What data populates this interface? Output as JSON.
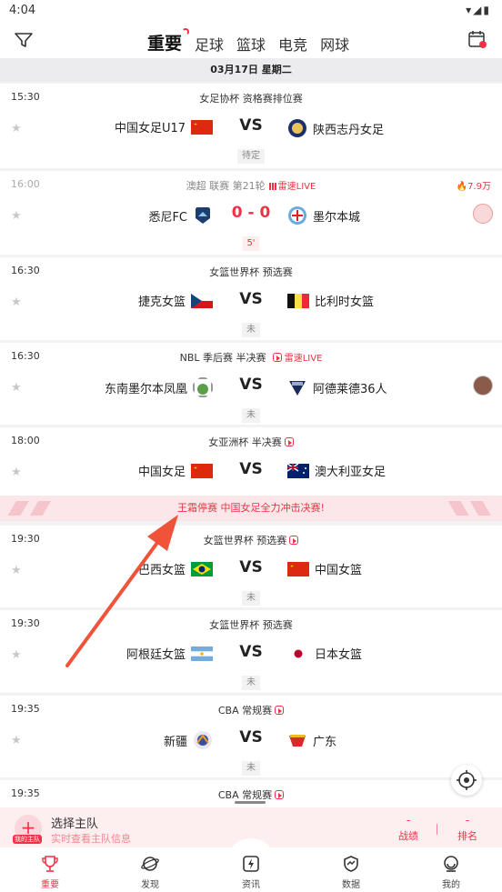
{
  "status_bar": {
    "time": "4:04",
    "icons": "▾◢▮"
  },
  "tabs": [
    "重要",
    "足球",
    "篮球",
    "电竞",
    "网球"
  ],
  "date_header": "03月17日 星期二",
  "matches": [
    {
      "time": "15:30",
      "competition": "女足协杯 资格赛排位赛",
      "home": "中国女足U17",
      "away": "陕西志丹女足",
      "center": "VS",
      "status": "待定"
    },
    {
      "time": "16:00",
      "competition": "澳超 联赛 第21轮",
      "live_label": "雷速LIVE",
      "heat": "7.9万",
      "home": "悉尼FC",
      "away": "墨尔本城",
      "center": "0 - 0",
      "status": "5'"
    },
    {
      "time": "16:30",
      "competition": "女篮世界杯 预选赛",
      "home": "捷克女篮",
      "away": "比利时女篮",
      "center": "VS",
      "status": "未"
    },
    {
      "time": "16:30",
      "competition": "NBL 季后赛 半决赛",
      "live_label": "雷速LIVE",
      "home": "东南墨尔本凤凰",
      "away": "阿德莱德36人",
      "center": "VS",
      "status": "未"
    },
    {
      "time": "18:00",
      "competition": "女亚洲杯 半决赛",
      "home": "中国女足",
      "away": "澳大利亚女足",
      "center": "VS"
    },
    {
      "time": "19:30",
      "competition": "女篮世界杯 预选赛",
      "home": "巴西女篮",
      "away": "中国女篮",
      "center": "VS",
      "status": "未"
    },
    {
      "time": "19:30",
      "competition": "女篮世界杯 预选赛",
      "home": "阿根廷女篮",
      "away": "日本女篮",
      "center": "VS",
      "status": "未"
    },
    {
      "time": "19:35",
      "competition": "CBA 常规赛",
      "home": "新疆",
      "away": "广东",
      "center": "VS",
      "status": "未"
    },
    {
      "time": "19:35",
      "competition": "CBA 常规赛"
    }
  ],
  "banner": "王霜停赛 中国女足全力冲击决赛!",
  "my_team": {
    "title": "选择主队",
    "subtitle": "实时查看主队信息",
    "badge": "我的主队",
    "stat1_value": "-",
    "stat1_label": "战绩",
    "stat2_value": "-",
    "stat2_label": "排名"
  },
  "nav": [
    "重要",
    "发现",
    "资讯",
    "数据",
    "我的"
  ],
  "colors": {
    "accent": "#ee3344"
  }
}
